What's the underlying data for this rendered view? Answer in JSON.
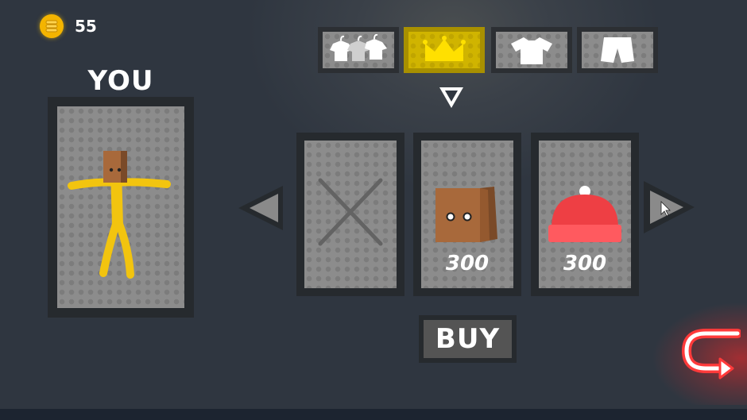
{
  "currency": {
    "coins": "55",
    "icon": "coin-stack-icon",
    "color": "#f4b400"
  },
  "player": {
    "title": "YOU"
  },
  "tabs": [
    {
      "name": "all-clothes",
      "icon": "hangers-clothes-icon",
      "active": false
    },
    {
      "name": "hats",
      "icon": "crown-icon",
      "active": true
    },
    {
      "name": "shirts",
      "icon": "tshirt-icon",
      "active": false
    },
    {
      "name": "pants",
      "icon": "shorts-icon",
      "active": false
    }
  ],
  "items": [
    {
      "name": "none",
      "icon": "x-icon",
      "price": ""
    },
    {
      "name": "paper-bag",
      "icon": "paper-bag-icon",
      "price": "300"
    },
    {
      "name": "beanie",
      "icon": "red-beanie-icon",
      "price": "300"
    }
  ],
  "actions": {
    "buy_label": "BUY"
  },
  "colors": {
    "accent": "#d0b400",
    "stickman": "#f2c40f",
    "back_button": "#ff3030"
  }
}
